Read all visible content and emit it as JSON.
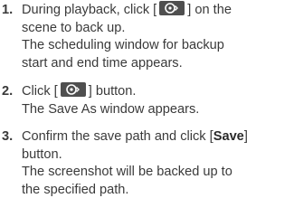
{
  "steps": [
    {
      "number": "1.",
      "text_a": "During playback, click [",
      "icon": "disc-backup-icon",
      "text_b": "] on the",
      "line2": "scene to back up.",
      "line3": "The scheduling window for backup",
      "line4": "start and end time appears."
    },
    {
      "number": "2.",
      "text_a": "Click [",
      "icon": "disc-backup-icon",
      "text_b": "] button.",
      "line2": "The Save As window appears."
    },
    {
      "number": "3.",
      "text_a": "Confirm the save path and click [",
      "bold": "Save",
      "text_b": "]",
      "line2": "button.",
      "line3": "The screenshot will be backed up to",
      "line4": "the specified path."
    }
  ],
  "colors": {
    "text": "#3a3a3a",
    "icon_bg": "#4f4f4f",
    "icon_fg": "#ffffff"
  }
}
